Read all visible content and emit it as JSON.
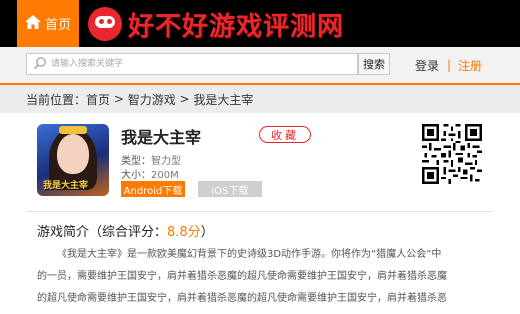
{
  "header": {
    "home_label": "首页",
    "site_name": "好不好游戏评测网"
  },
  "search": {
    "placeholder": "请输入搜索关键字",
    "button_label": "搜索"
  },
  "account": {
    "login_label": "登录",
    "divider": "|",
    "register_label": "注册"
  },
  "breadcrumb": {
    "prefix": "当前位置：",
    "items": [
      "首页",
      "智力游戏",
      "我是大主宰"
    ],
    "separator": " > "
  },
  "game": {
    "icon_text": "我是大主宰",
    "title": "我是大主宰",
    "favorite_label": "收藏",
    "type_key": "类型：",
    "type_value": "智力型",
    "size_key": "大小：",
    "size_value": "200M",
    "android_label": "Android下载",
    "ios_label": "iOS下载"
  },
  "intro": {
    "heading": "游戏简介",
    "score_prefix": "（综合评分：",
    "score": "8.8分",
    "score_suffix": "）",
    "lines": [
      "《我是大主宰》是一款欧美魔幻背景下的史诗级3D动作手游。你将作为“猎魔人公会”中",
      "的一员，需要维护王国安宁，肩并着猎杀恶魔的超凡使命需要维护王国安宁，肩并着猎杀恶魔",
      "的超凡使命需要维护王国安宁，肩并着猎杀恶魔的超凡使命需要维护王国安宁，肩并着猎杀恶"
    ]
  },
  "colors": {
    "accent": "#ff7a00",
    "brand_red": "#e8282c",
    "header_bg": "#000000"
  },
  "icons": {
    "home": "home-icon",
    "search": "search-icon",
    "qr": "qr-code-icon"
  }
}
